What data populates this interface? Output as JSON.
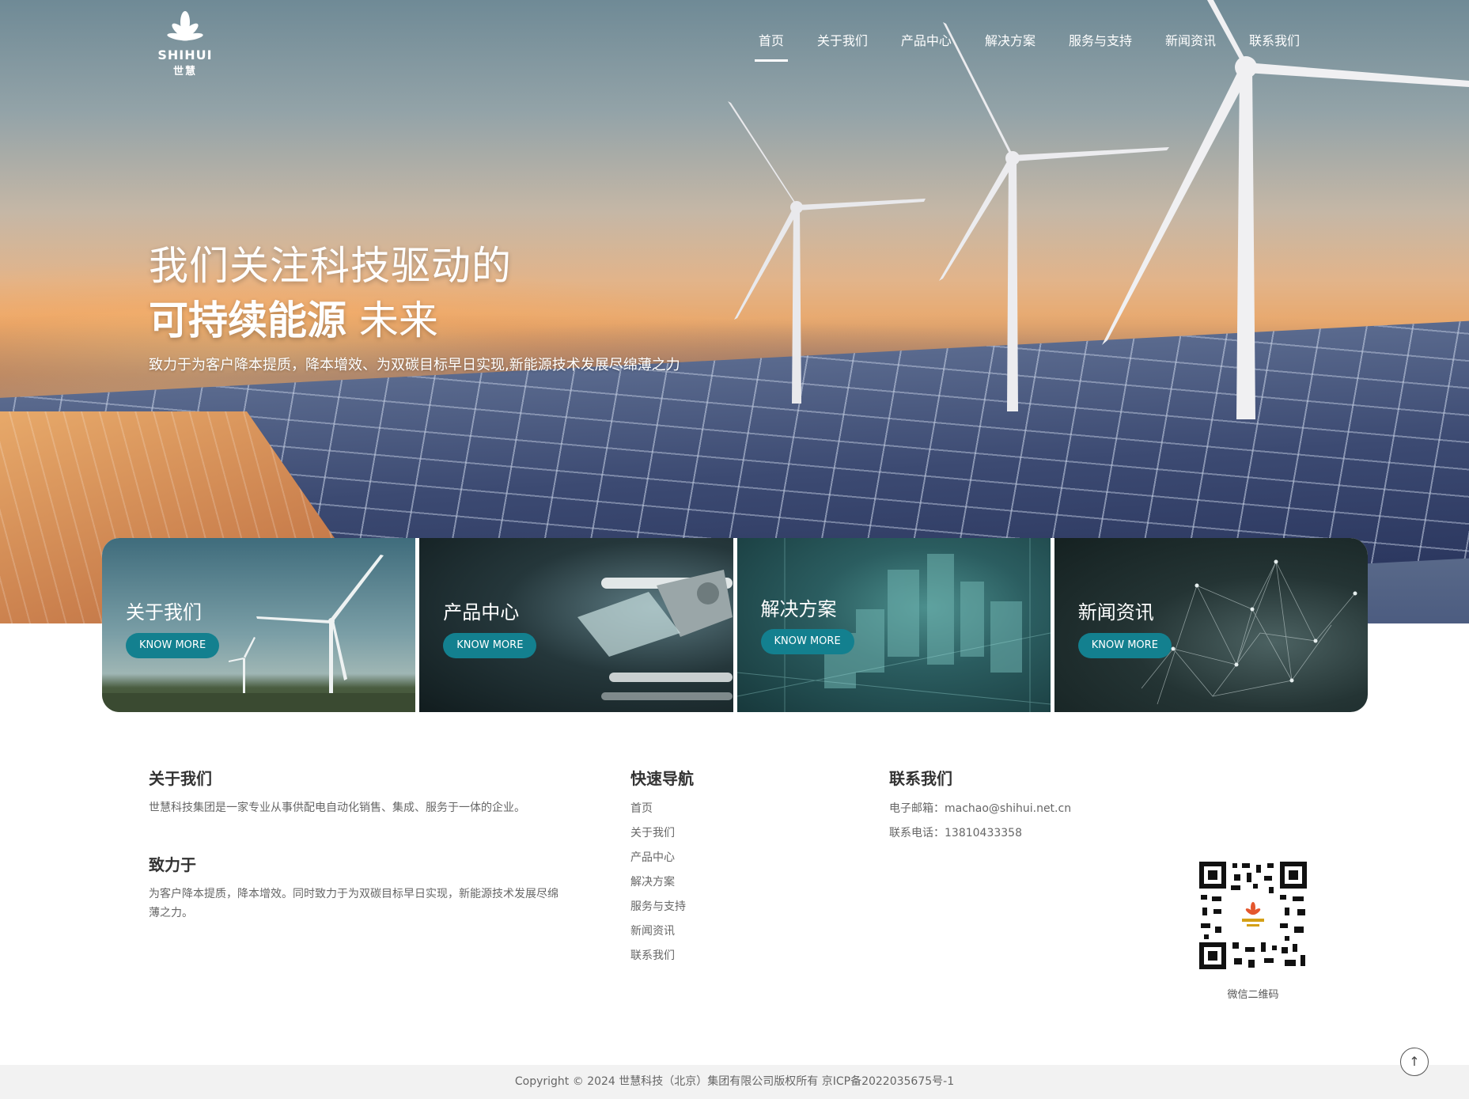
{
  "brand": {
    "logo_text": "SHIHUI",
    "logo_cn": "世慧",
    "accent_color": "#13808f"
  },
  "nav": {
    "items": [
      {
        "label": "首页",
        "active": true
      },
      {
        "label": "关于我们",
        "active": false
      },
      {
        "label": "产品中心",
        "active": false
      },
      {
        "label": "解决方案",
        "active": false
      },
      {
        "label": "服务与支持",
        "active": false
      },
      {
        "label": "新闻资讯",
        "active": false
      },
      {
        "label": "联系我们",
        "active": false
      }
    ]
  },
  "hero": {
    "line1": "我们关注科技驱动的",
    "line2_bold": "可持续能源",
    "line2_rest": "未来",
    "subtitle": "致力于为客户降本提质，降本增效、为双碳目标早日实现,新能源技术发展尽绵薄之力"
  },
  "cards": [
    {
      "title": "关于我们",
      "button": "KNOW MORE"
    },
    {
      "title": "产品中心",
      "button": "KNOW MORE"
    },
    {
      "title": "解决方案",
      "button": "KNOW MORE"
    },
    {
      "title": "新闻资讯",
      "button": "KNOW MORE"
    }
  ],
  "footer": {
    "about": {
      "heading": "关于我们",
      "text": "世慧科技集团是一家专业从事供配电自动化销售、集成、服务于一体的企业。"
    },
    "mission": {
      "heading": "致力于",
      "text": "为客户降本提质，降本增效。同时致力于为双碳目标早日实现，新能源技术发展尽绵薄之力。"
    },
    "quick_nav": {
      "heading": "快速导航",
      "links": [
        "首页",
        "关于我们",
        "产品中心",
        "解决方案",
        "服务与支持",
        "新闻资讯",
        "联系我们"
      ]
    },
    "contact": {
      "heading": "联系我们",
      "email": "电子邮箱：machao@shihui.net.cn",
      "phone": "联系电话：13810433358"
    },
    "qr_label": "微信二维码",
    "copyright": "Copyright © 2024 世慧科技（北京）集团有限公司版权所有 京ICP备2022035675号-1",
    "back_to_top_icon": "arrow-up-icon"
  }
}
